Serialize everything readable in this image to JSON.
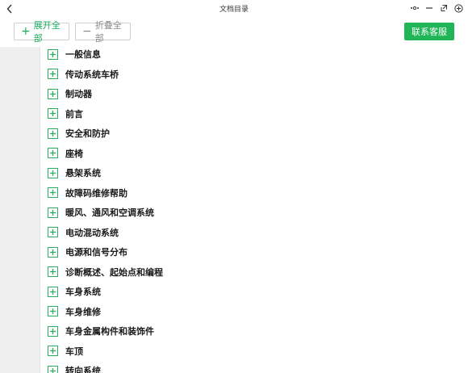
{
  "window": {
    "title": "文档目录",
    "back_icon": "chevron-left-icon",
    "controls": [
      "more-icon",
      "minimize-icon",
      "restore-icon",
      "add-circle-icon"
    ]
  },
  "toolbar": {
    "expand_label": "展开全部",
    "collapse_label": "折叠全部",
    "contact_label": "联系客服",
    "accent_color": "#20b557"
  },
  "tree": {
    "toggle_icon": "plus-box-icon",
    "items": [
      {
        "label": "一般信息"
      },
      {
        "label": "传动系统车桥"
      },
      {
        "label": "制动器"
      },
      {
        "label": "前言"
      },
      {
        "label": "安全和防护"
      },
      {
        "label": "座椅"
      },
      {
        "label": "悬架系统"
      },
      {
        "label": "故障码维修帮助"
      },
      {
        "label": "暖风、通风和空调系统"
      },
      {
        "label": "电动混动系统"
      },
      {
        "label": "电源和信号分布"
      },
      {
        "label": "诊断概述、起始点和编程"
      },
      {
        "label": "车身系统"
      },
      {
        "label": "车身维修"
      },
      {
        "label": "车身金属构件和装饰件"
      },
      {
        "label": "车顶"
      },
      {
        "label": "转向系统"
      }
    ]
  }
}
